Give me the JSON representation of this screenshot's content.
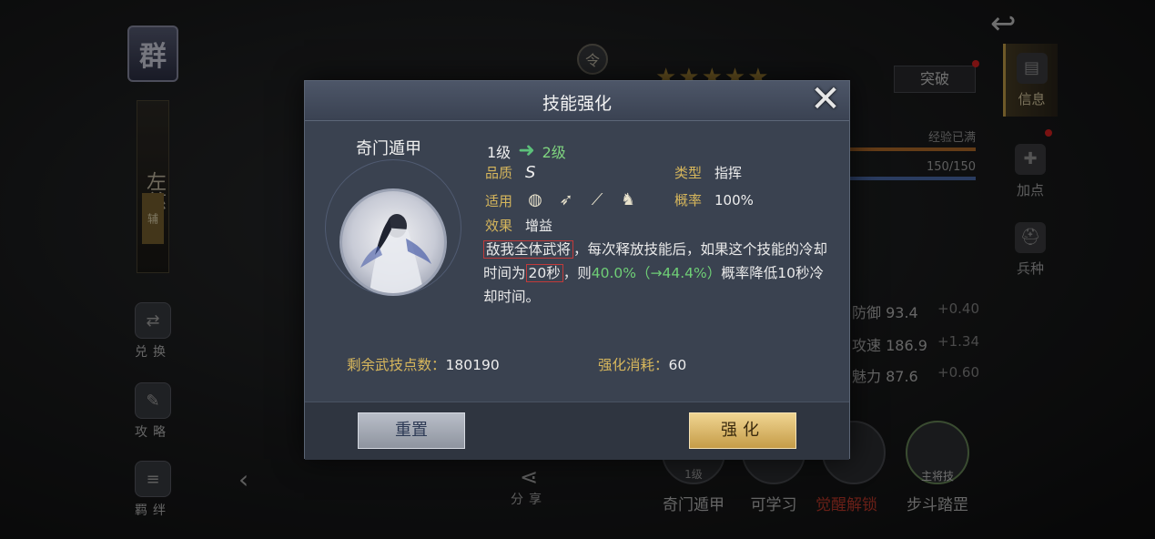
{
  "background": {
    "faction_badge": "群",
    "hero_name": "左慈",
    "role_tag": "辅",
    "left_menu": [
      {
        "label": "兑换",
        "icon": "exchange-icon"
      },
      {
        "label": "攻略",
        "icon": "guide-icon"
      },
      {
        "label": "羁绊",
        "icon": "bond-icon"
      }
    ],
    "order_badge": "令",
    "stars": "★★★★★",
    "breakthrough_label": "突破",
    "right_tabs": [
      {
        "label": "信息",
        "icon": "scroll-icon"
      },
      {
        "label": "加点",
        "icon": "add-point-icon"
      },
      {
        "label": "兵种",
        "icon": "helmet-icon"
      }
    ],
    "exp_status": "经验已满",
    "exp_value": "150/150",
    "stats": [
      {
        "name": "防御",
        "value": "93.4",
        "plus": "+0.40"
      },
      {
        "name": "攻速",
        "value": "186.9",
        "plus": "+1.34"
      },
      {
        "name": "魅力",
        "value": "87.6",
        "plus": "+0.60"
      }
    ],
    "skills": [
      {
        "label": "奇门遁甲",
        "level": "1级"
      },
      {
        "label": "可学习",
        "level": ""
      },
      {
        "label": "觉醒解锁",
        "level": ""
      },
      {
        "label": "步斗踏罡",
        "level": "主将技"
      }
    ],
    "share_label": "分享",
    "colors": {
      "locked_skill": "#c0392b",
      "accent_gold": "#c9a24a"
    }
  },
  "dialog": {
    "title": "技能强化",
    "skill_name": "奇门遁甲",
    "level_from": "1级",
    "level_to": "2级",
    "quality_label": "品质",
    "quality_value": "S",
    "type_label": "类型",
    "type_value": "指挥",
    "applicable_label": "适用",
    "applicable_icons": [
      "shield-icon",
      "bow-icon",
      "spear-icon",
      "horse-icon"
    ],
    "chance_label": "概率",
    "chance_value": "100%",
    "effect_label": "效果",
    "effect_value": "增益",
    "effect_text": {
      "part1": "敌我全体武将",
      "part2": "，每次释放技能后，如果这个技能的冷却时间为",
      "part3": "20秒",
      "part4": "，则",
      "part5": "40.0%（→44.4%）",
      "part6": "概率降低10秒冷却时间。"
    },
    "remaining_label": "剩余武技点数：",
    "remaining_value": "180190",
    "cost_label": "强化消耗：",
    "cost_value": "60",
    "reset_button": "重置",
    "upgrade_button": "强化"
  }
}
